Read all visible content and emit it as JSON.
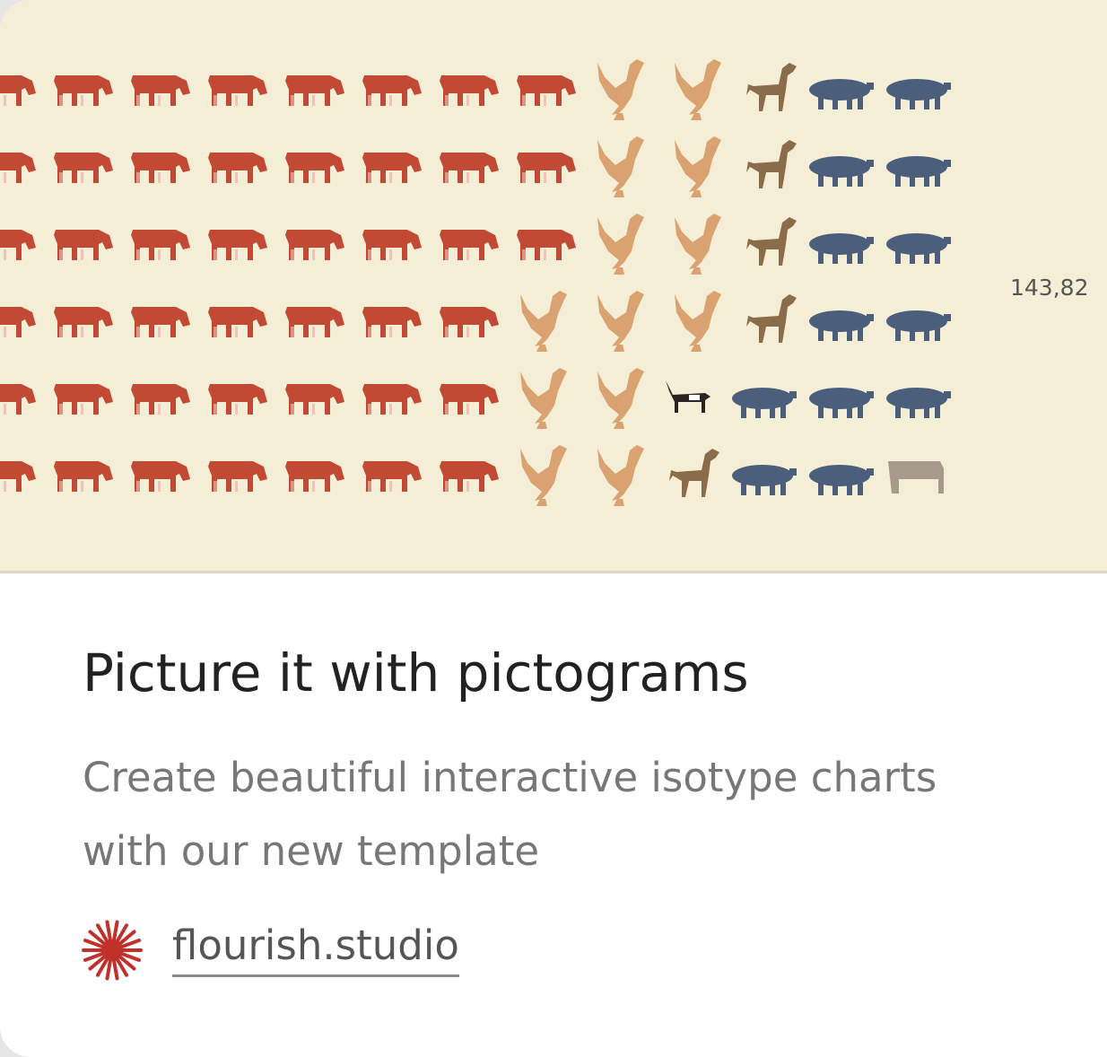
{
  "card": {
    "title": "Picture it with pictograms",
    "description": "Create beautiful interactive isotype charts with our new template",
    "link_text": "flourish.studio",
    "logo_icon": "flourish-starburst-icon"
  },
  "preview": {
    "value_label": "143,82",
    "colors": {
      "background": "#f5eed6",
      "cattle": "#c24a34",
      "chicken": "#d9a270",
      "horse": "#8a6b4a",
      "pig": "#4b5f7d",
      "other": "#a89a8a",
      "brand": "#c0312b"
    },
    "rows": [
      [
        "cow",
        "cow",
        "cow",
        "cow",
        "cow",
        "cow",
        "cow",
        "cow",
        "chicken",
        "chicken",
        "horse",
        "pig",
        "pig"
      ],
      [
        "cow",
        "cow",
        "cow",
        "cow",
        "cow",
        "cow",
        "cow",
        "cow",
        "chicken",
        "chicken",
        "horse",
        "pig",
        "pig"
      ],
      [
        "cow",
        "cow",
        "cow",
        "cow",
        "cow",
        "cow",
        "cow",
        "cow",
        "chicken",
        "chicken",
        "horse",
        "pig",
        "pig"
      ],
      [
        "cow",
        "cow",
        "cow",
        "cow",
        "cow",
        "cow",
        "cow",
        "chicken",
        "chicken",
        "chicken",
        "horse",
        "pig",
        "pig"
      ],
      [
        "cow",
        "cow",
        "cow",
        "cow",
        "cow",
        "cow",
        "cow",
        "chicken",
        "chicken",
        "goat",
        "pig",
        "pig",
        "pig"
      ],
      [
        "cow",
        "cow",
        "cow",
        "cow",
        "cow",
        "cow",
        "cow",
        "chicken",
        "chicken",
        "horse",
        "pig",
        "pig",
        "sheep"
      ]
    ]
  }
}
